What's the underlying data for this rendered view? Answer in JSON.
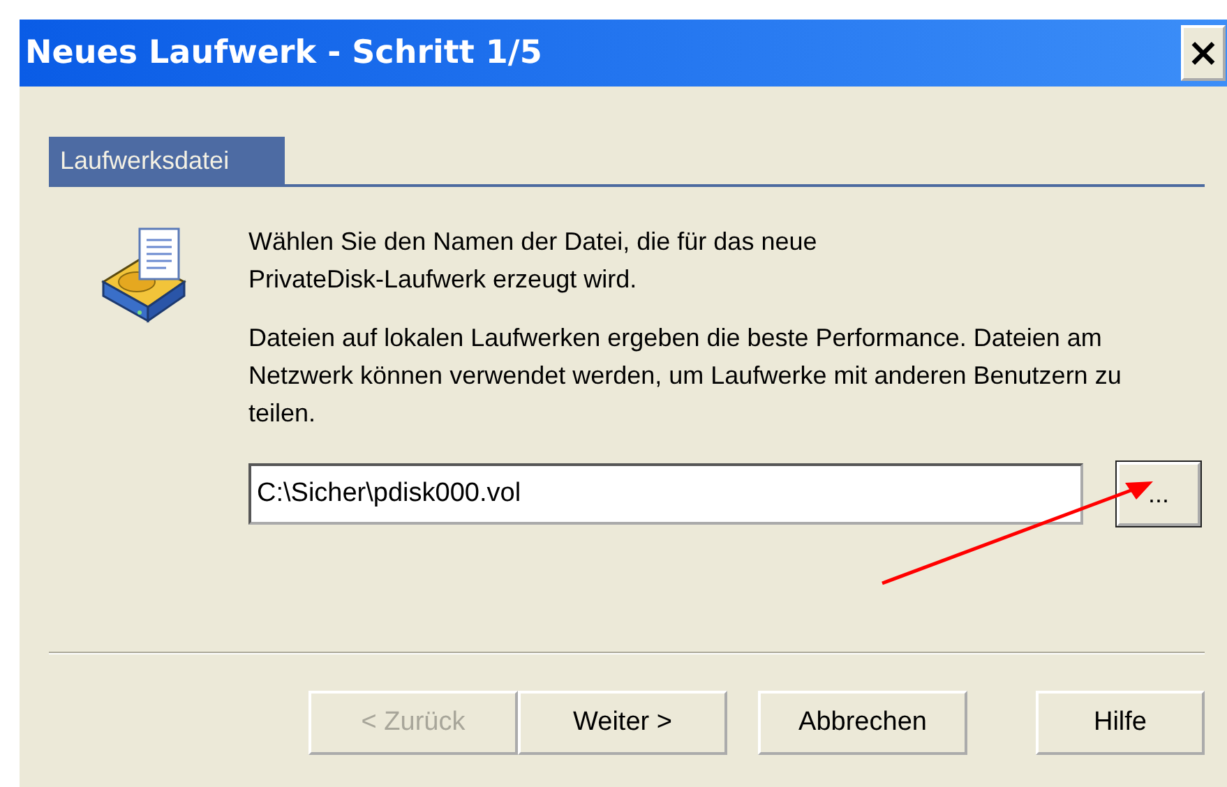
{
  "window": {
    "title": "Neues Laufwerk - Schritt 1/5",
    "close_glyph": "×"
  },
  "tabs": [
    {
      "label": "Laufwerksdatei",
      "selected": true
    }
  ],
  "paragraphs": [
    "Wählen Sie den Namen der Datei, die für das neue PrivateDisk-Laufwerk erzeugt wird.",
    "Dateien auf lokalen Laufwerken ergeben die beste Performance. Dateien am Netzwerk können verwendet werden, um Laufwerke mit anderen Benutzern zu teilen."
  ],
  "file_field": {
    "value": "C:\\Sicher\\pdisk000.vol"
  },
  "browse_button": {
    "label": "..."
  },
  "buttons": [
    {
      "label": "< Zurück",
      "disabled": true
    },
    {
      "label": "Weiter >",
      "disabled": false
    },
    {
      "label": "Abbrechen",
      "disabled": false
    },
    {
      "label": "Hilfe",
      "disabled": false
    }
  ]
}
